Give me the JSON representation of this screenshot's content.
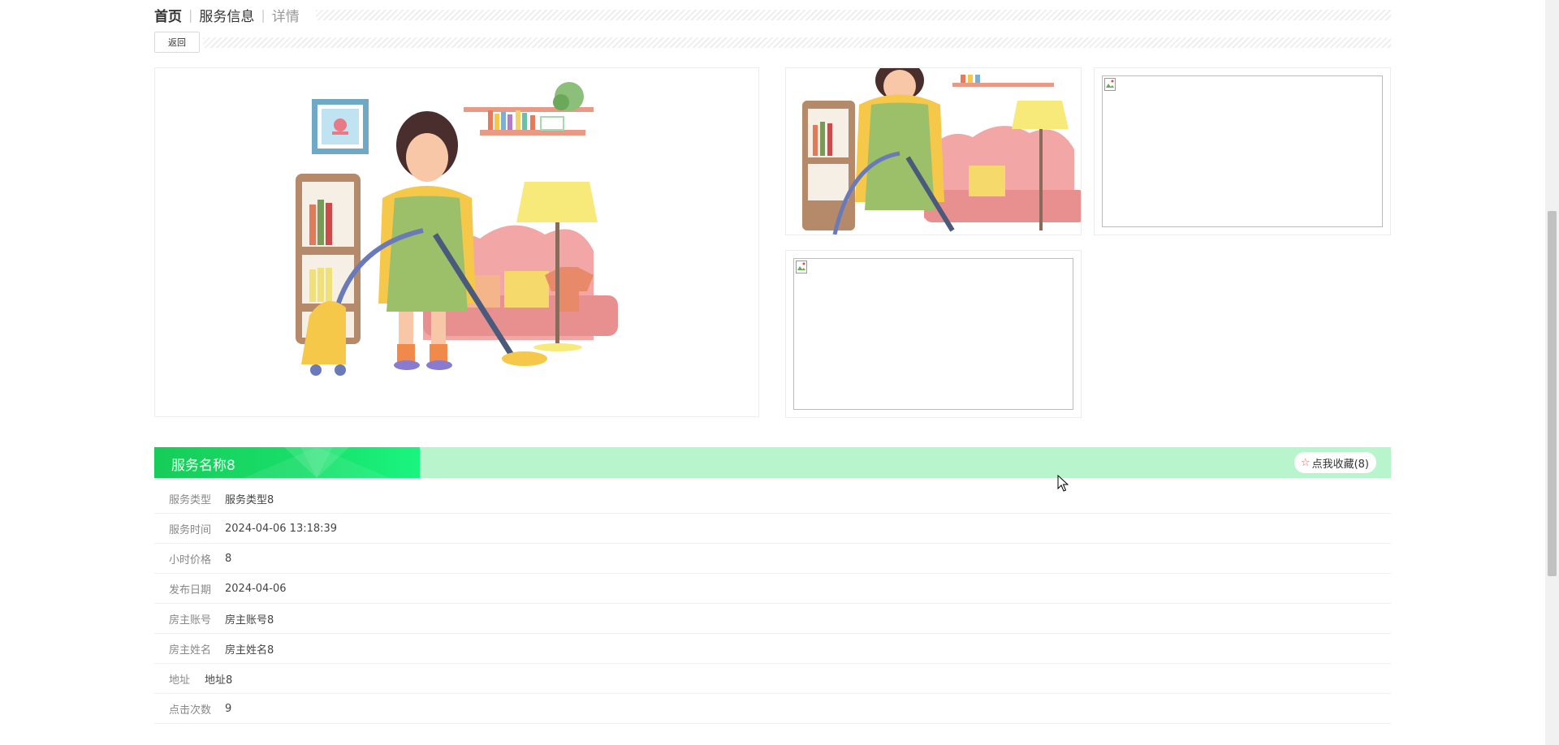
{
  "breadcrumb": {
    "home": "首页",
    "section": "服务信息",
    "current": "详情",
    "separator": "|"
  },
  "back_label": "返回",
  "service": {
    "title": "服务名称8",
    "favorite_label": "点我收藏(8)",
    "fields": [
      {
        "label": "服务类型",
        "value": "服务类型8"
      },
      {
        "label": "服务时间",
        "value": "2024-04-06 13:18:39"
      },
      {
        "label": "小时价格",
        "value": "8"
      },
      {
        "label": "发布日期",
        "value": "2024-04-06"
      },
      {
        "label": "房主账号",
        "value": "房主账号8"
      },
      {
        "label": "房主姓名",
        "value": "房主姓名8"
      },
      {
        "label": "地址",
        "value": "地址8"
      },
      {
        "label": "点击次数",
        "value": "9"
      }
    ]
  },
  "colors": {
    "title_green": "#18e06b",
    "bar_green": "#b8f5cc",
    "star": "#e05a5a"
  },
  "icons": {
    "favorite": "star-outline-icon",
    "broken_image": "broken-image-icon"
  }
}
